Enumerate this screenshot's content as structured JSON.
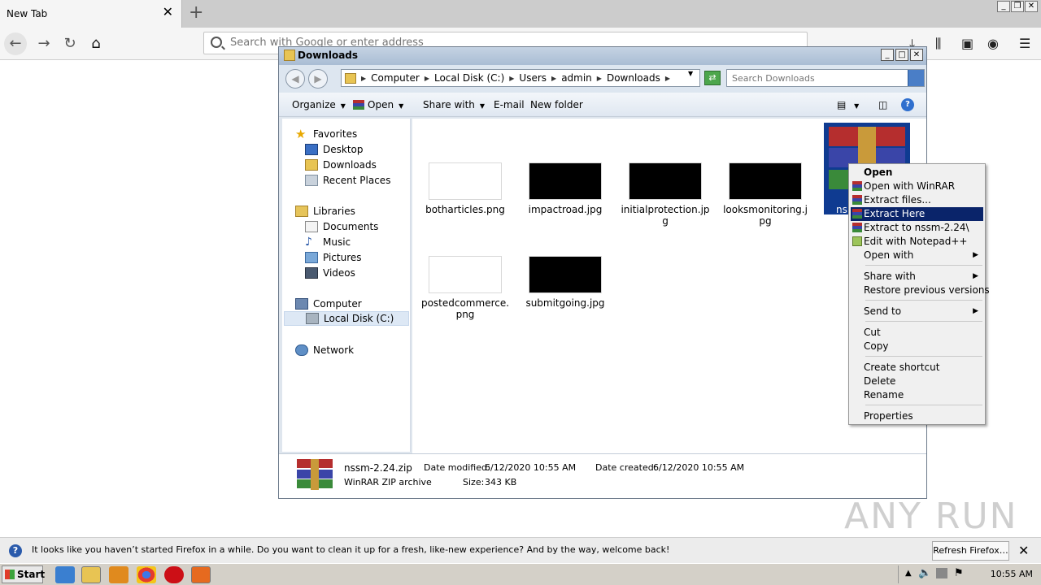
{
  "browser": {
    "tab_title": "New Tab",
    "url_placeholder": "Search with Google or enter address"
  },
  "explorer": {
    "title": "Downloads",
    "breadcrumb": [
      "Computer",
      "Local Disk (C:)",
      "Users",
      "admin",
      "Downloads"
    ],
    "search_placeholder": "Search Downloads",
    "toolbar": {
      "organize": "Organize",
      "open": "Open",
      "share_with": "Share with",
      "email": "E-mail",
      "new_folder": "New folder"
    },
    "sidebar": {
      "favorites": "Favorites",
      "desktop": "Desktop",
      "downloads": "Downloads",
      "recent_places": "Recent Places",
      "libraries": "Libraries",
      "documents": "Documents",
      "music": "Music",
      "pictures": "Pictures",
      "videos": "Videos",
      "computer": "Computer",
      "local_disk": "Local Disk (C:)",
      "network": "Network"
    },
    "files": [
      {
        "name": "botharticles.png"
      },
      {
        "name": "impactroad.jpg"
      },
      {
        "name": "initialprotection.jpg"
      },
      {
        "name": "looksmonitoring.jpg"
      },
      {
        "name": "ns"
      },
      {
        "name": "postedcommerce.png"
      },
      {
        "name": "submitgoing.jpg"
      }
    ],
    "details": {
      "filename": "nssm-2.24.zip",
      "type": "WinRAR ZIP archive",
      "date_modified_label": "Date modified:",
      "date_modified": "6/12/2020 10:55 AM",
      "date_created_label": "Date created:",
      "date_created": "6/12/2020 10:55 AM",
      "size_label": "Size:",
      "size": "343 KB"
    }
  },
  "context_menu": {
    "open": "Open",
    "open_winrar": "Open with WinRAR",
    "extract_files": "Extract files...",
    "extract_here": "Extract Here",
    "extract_to": "Extract to nssm-2.24\\",
    "edit_notepad": "Edit with Notepad++",
    "open_with": "Open with",
    "share_with": "Share with",
    "restore": "Restore previous versions",
    "send_to": "Send to",
    "cut": "Cut",
    "copy": "Copy",
    "create_shortcut": "Create shortcut",
    "delete": "Delete",
    "rename": "Rename",
    "properties": "Properties"
  },
  "notification": {
    "message": "It looks like you haven’t started Firefox in a while. Do you want to clean it up for a fresh, like-new experience? And by the way, welcome back!",
    "button": "Refresh Firefox…"
  },
  "taskbar": {
    "start": "Start",
    "clock": "10:55 AM"
  },
  "watermark": "ANY RUN",
  "colors": {
    "menu_highlight": "#0a246a",
    "window_frame": "#dfe6ee"
  }
}
